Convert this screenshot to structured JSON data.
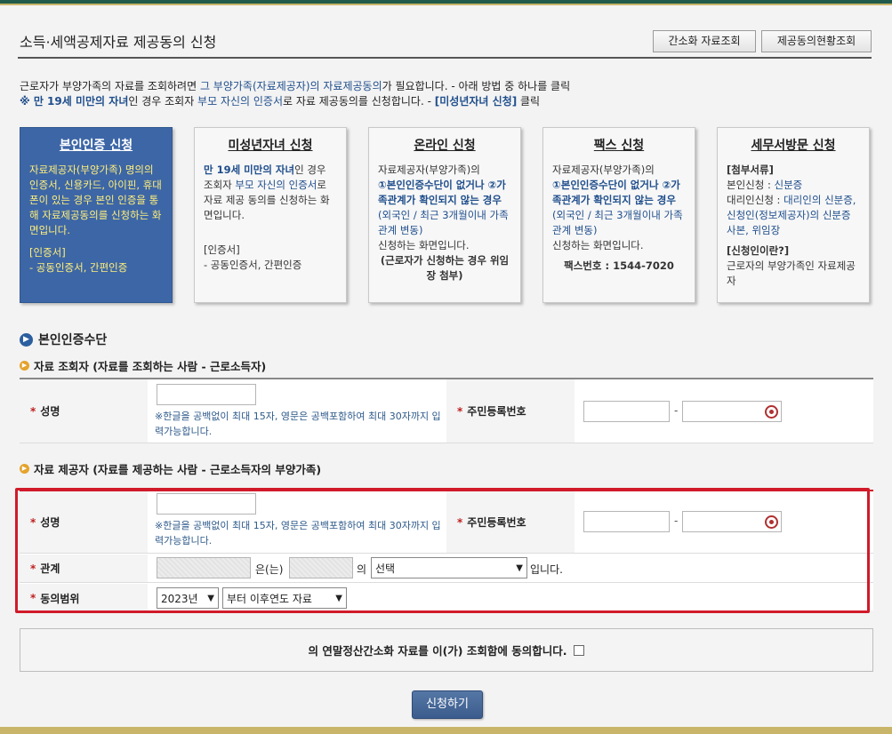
{
  "header": {
    "title": "소득·세액공제자료 제공동의 신청",
    "btn_simple_lookup": "간소화 자료조회",
    "btn_consent_status": "제공동의현황조회"
  },
  "intro": {
    "line1_a": "근로자가 부양가족의 자료를 조회하려면 ",
    "line1_hl": "그 부양가족(자료제공자)의 자료제공동의",
    "line1_b": "가 필요합니다. - 아래 방법 중 하나를 클릭",
    "line2_a": "※ 만 19세 미만의 자녀",
    "line2_b": "인 경우 조회자 ",
    "line2_c": "부모 자신의 인증서",
    "line2_d": "로 자료 제공동의를 신청합니다. - ",
    "line2_e": "[미성년자녀 신청]",
    "line2_f": " 클릭"
  },
  "cards": [
    {
      "title": "본인인증 신청",
      "lines": [
        "자료제공자(부양가족) 명의의 인증서, 신용카드, 아이핀, 휴대폰이 있는 경우 본인 인증을 통해 자료제공동의를 신청하는 화면입니다."
      ],
      "cert_label": "[인증서]",
      "cert_value": "- 공동인증서, 간편인증"
    },
    {
      "title": "미성년자녀 신청",
      "p1_bold": "만 19세 미만의 자녀",
      "p1_a": "인 경우 조회자 ",
      "p1_blue": "부모 자신의 인증서",
      "p1_b": "로 자료 제공 동의를 신청하는 화면입니다.",
      "cert_label": "[인증서]",
      "cert_value": "- 공동인증서, 간편인증"
    },
    {
      "title": "온라인 신청",
      "p1": "자료제공자(부양가족)의",
      "p2": "①본인인증수단이 없거나 ②가족관계가 확인되지 않는 경우",
      "p3": "(외국인 / 최근 3개월이내 가족관계 변동)",
      "p4": "신청하는 화면입니다.",
      "p5": "(근로자가 신청하는 경우 위임장 첨부)"
    },
    {
      "title": "팩스 신청",
      "p1": "자료제공자(부양가족)의",
      "p2": "①본인인증수단이 없거나 ②가족관계가 확인되지 않는 경우",
      "p3": "(외국인 / 최근 3개월이내 가족관계 변동)",
      "p4": "신청하는 화면입니다.",
      "fax": "팩스번호 : 1544-7020"
    },
    {
      "title": "세무서방문 신청",
      "docs_label": "[첨부서류]",
      "self_a": "본인신청 : ",
      "self_b": "신분증",
      "proxy_a": "대리인신청 : ",
      "proxy_b": "대리인의 신분증, 신청인(정보제공자)의 신분증 사본, 위임장",
      "who_label": "[신청인이란?]",
      "who_value": "근로자의 부양가족인 자료제공자"
    }
  ],
  "section": {
    "title": "본인인증수단",
    "viewer_title": "자료 조회자 (자료를 조회하는 사람 - 근로소득자)",
    "provider_title": "자료 제공자 (자료를 제공하는 사람 - 근로소득자의 부양가족)"
  },
  "form": {
    "star": "*",
    "name_label": "성명",
    "rrn_label": "주민등록번호",
    "relation_label": "관계",
    "scope_label": "동의범위",
    "name_note": "※한글을 공백없이 최대 15자, 영문은 공백포함하여 최대 30자까지 입력가능합니다.",
    "dash": "-",
    "relation_mid": "은(는)",
    "relation_of": "의",
    "relation_select": "선택",
    "relation_end": "입니다.",
    "year_select": "2023년",
    "scope_select": "부터 이후연도 자료"
  },
  "agree": {
    "text": "의 연말정산간소화 자료를 이(가) 조회함에 동의합니다."
  },
  "submit_label": "신청하기",
  "colors": {
    "active_card": "#3d66a6",
    "highlight_border": "#d11a2a",
    "link_blue": "#1f4e8c"
  }
}
